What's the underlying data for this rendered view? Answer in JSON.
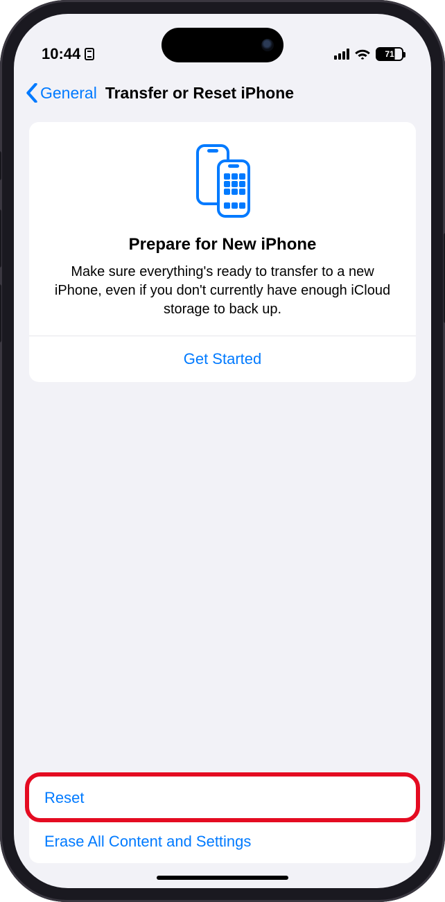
{
  "status": {
    "time": "10:44",
    "battery_pct": "71"
  },
  "nav": {
    "back_label": "General",
    "title": "Transfer or Reset iPhone"
  },
  "card": {
    "title": "Prepare for New iPhone",
    "description": "Make sure everything's ready to transfer to a new iPhone, even if you don't currently have enough iCloud storage to back up.",
    "action": "Get Started"
  },
  "list": {
    "reset": "Reset",
    "erase": "Erase All Content and Settings"
  },
  "colors": {
    "accent": "#007aff",
    "highlight": "#e40b21",
    "background": "#f2f2f7"
  }
}
